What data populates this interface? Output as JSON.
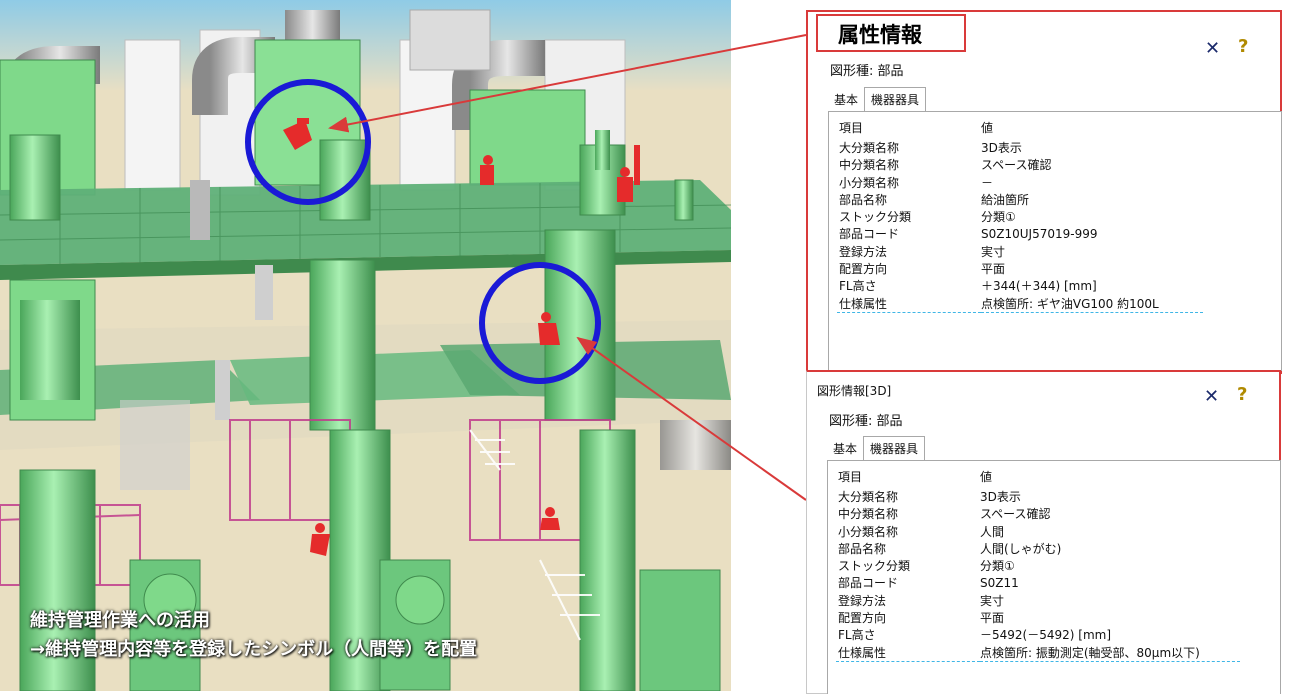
{
  "caption": {
    "line1": "維持管理作業への活用",
    "line2": "→維持管理内容等を登録したシンボル（人間等）を配置"
  },
  "panel1": {
    "title": "属性情報",
    "shape_type": "図形種: 部品",
    "tabs": [
      "基本",
      "機器器具"
    ],
    "active_tab": 1,
    "close_icon": "close-icon",
    "help_icon": "help-icon",
    "header": {
      "key": "項目",
      "value": "値"
    },
    "rows": [
      {
        "key": "大分類名称",
        "value": "3D表示"
      },
      {
        "key": "中分類名称",
        "value": "スペース確認"
      },
      {
        "key": "小分類名称",
        "value": "－"
      },
      {
        "key": "部品名称",
        "value": "給油箇所"
      },
      {
        "key": "ストック分類",
        "value": "分類①"
      },
      {
        "key": "部品コード",
        "value": "S0Z10UJ57019-999"
      },
      {
        "key": "登録方法",
        "value": "実寸"
      },
      {
        "key": "配置方向",
        "value": "平面"
      },
      {
        "key": "FL高さ",
        "value": "＋344(＋344) [mm]"
      },
      {
        "key": "仕様属性",
        "value": "点検箇所: ギヤ油VG100 約100L"
      }
    ]
  },
  "panel2": {
    "title": "図形情報[3D]",
    "shape_type": "図形種: 部品",
    "tabs": [
      "基本",
      "機器器具"
    ],
    "active_tab": 1,
    "close_icon": "close-icon",
    "help_icon": "help-icon",
    "header": {
      "key": "項目",
      "value": "値"
    },
    "rows": [
      {
        "key": "大分類名称",
        "value": "3D表示"
      },
      {
        "key": "中分類名称",
        "value": "スペース確認"
      },
      {
        "key": "小分類名称",
        "value": "人間"
      },
      {
        "key": "部品名称",
        "value": "人間(しゃがむ)"
      },
      {
        "key": "ストック分類",
        "value": "分類①"
      },
      {
        "key": "部品コード",
        "value": "S0Z11"
      },
      {
        "key": "登録方法",
        "value": "実寸"
      },
      {
        "key": "配置方向",
        "value": "平面"
      },
      {
        "key": "FL高さ",
        "value": "－5492(－5492) [mm]"
      },
      {
        "key": "仕様属性",
        "value": "点検箇所: 振動測定(軸受部、80μm以下)"
      }
    ]
  },
  "colors": {
    "equipment_green": "#7fd98a",
    "platform_green": "#5fb078",
    "symbol_red": "#e52b2b",
    "highlight_circle": "#1a1ad6",
    "callout_red": "#d93a3a"
  }
}
